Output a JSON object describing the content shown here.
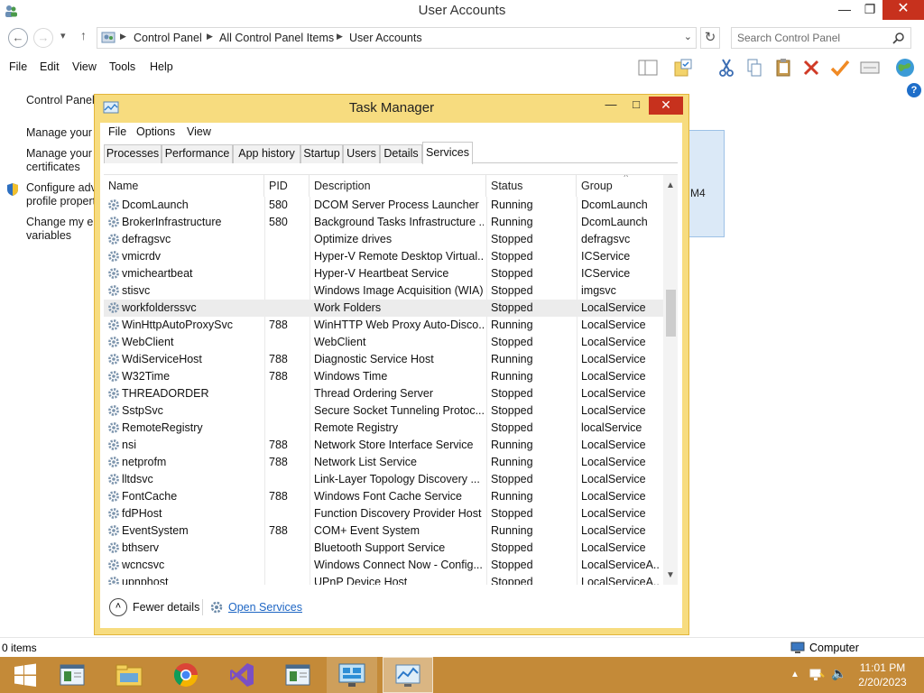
{
  "explorer": {
    "title": "User Accounts",
    "breadcrumb": [
      "Control Panel",
      "All Control Panel Items",
      "User Accounts"
    ],
    "search_placeholder": "Search Control Panel",
    "menu": [
      "File",
      "Edit",
      "View",
      "Tools",
      "Help"
    ],
    "left_links": {
      "home": "Control Panel",
      "l1": "Manage your",
      "l2a": "Manage your f",
      "l2b": "certificates",
      "l3a": "Configure adv",
      "l3b": "profile propert",
      "l4a": "Change my er",
      "l4b": "variables"
    },
    "panel_text": "M4",
    "status_items": "0 items",
    "status_location": "Computer"
  },
  "taskmgr": {
    "title": "Task Manager",
    "menu": [
      "File",
      "Options",
      "View"
    ],
    "tabs": [
      "Processes",
      "Performance",
      "App history",
      "Startup",
      "Users",
      "Details",
      "Services"
    ],
    "active_tab": "Services",
    "columns": [
      "Name",
      "PID",
      "Description",
      "Status",
      "Group"
    ],
    "selected_row": 6,
    "rows": [
      [
        "DcomLaunch",
        "580",
        "DCOM Server Process Launcher",
        "Running",
        "DcomLaunch"
      ],
      [
        "BrokerInfrastructure",
        "580",
        "Background Tasks Infrastructure ...",
        "Running",
        "DcomLaunch"
      ],
      [
        "defragsvc",
        "",
        "Optimize drives",
        "Stopped",
        "defragsvc"
      ],
      [
        "vmicrdv",
        "",
        "Hyper-V Remote Desktop Virtual...",
        "Stopped",
        "ICService"
      ],
      [
        "vmicheartbeat",
        "",
        "Hyper-V Heartbeat Service",
        "Stopped",
        "ICService"
      ],
      [
        "stisvc",
        "",
        "Windows Image Acquisition (WIA)",
        "Stopped",
        "imgsvc"
      ],
      [
        "workfolderssvc",
        "",
        "Work Folders",
        "Stopped",
        "LocalService"
      ],
      [
        "WinHttpAutoProxySvc",
        "788",
        "WinHTTP Web Proxy Auto-Disco...",
        "Running",
        "LocalService"
      ],
      [
        "WebClient",
        "",
        "WebClient",
        "Stopped",
        "LocalService"
      ],
      [
        "WdiServiceHost",
        "788",
        "Diagnostic Service Host",
        "Running",
        "LocalService"
      ],
      [
        "W32Time",
        "788",
        "Windows Time",
        "Running",
        "LocalService"
      ],
      [
        "THREADORDER",
        "",
        "Thread Ordering Server",
        "Stopped",
        "LocalService"
      ],
      [
        "SstpSvc",
        "",
        "Secure Socket Tunneling Protoc...",
        "Stopped",
        "LocalService"
      ],
      [
        "RemoteRegistry",
        "",
        "Remote Registry",
        "Stopped",
        "localService"
      ],
      [
        "nsi",
        "788",
        "Network Store Interface Service",
        "Running",
        "LocalService"
      ],
      [
        "netprofm",
        "788",
        "Network List Service",
        "Running",
        "LocalService"
      ],
      [
        "lltdsvc",
        "",
        "Link-Layer Topology Discovery ...",
        "Stopped",
        "LocalService"
      ],
      [
        "FontCache",
        "788",
        "Windows Font Cache Service",
        "Running",
        "LocalService"
      ],
      [
        "fdPHost",
        "",
        "Function Discovery Provider Host",
        "Stopped",
        "LocalService"
      ],
      [
        "EventSystem",
        "788",
        "COM+ Event System",
        "Running",
        "LocalService"
      ],
      [
        "bthserv",
        "",
        "Bluetooth Support Service",
        "Stopped",
        "LocalService"
      ],
      [
        "wcncsvc",
        "",
        "Windows Connect Now - Config...",
        "Stopped",
        "LocalServiceA..."
      ],
      [
        "upnphost",
        "",
        "UPnP Device Host",
        "Stopped",
        "LocalServiceA..."
      ]
    ],
    "fewer_details": "Fewer details",
    "open_services": "Open Services"
  },
  "taskbar": {
    "time": "11:01 PM",
    "date": "2/20/2023"
  },
  "colors": {
    "taskbar": "#c48a38",
    "taskmgr_frame": "#f7dc7f",
    "close_button": "#c7311d",
    "link": "#1e66c4"
  },
  "icons": [
    "user-accounts-icon",
    "back-arrow-icon",
    "forward-arrow-icon",
    "up-arrow-icon",
    "refresh-icon",
    "search-icon",
    "gear-icon",
    "services-icon",
    "start-icon",
    "chrome-icon",
    "visual-studio-icon",
    "folder-icon",
    "network-icon",
    "volume-icon",
    "flag-icon",
    "computer-icon",
    "help-icon",
    "shield-icon"
  ]
}
